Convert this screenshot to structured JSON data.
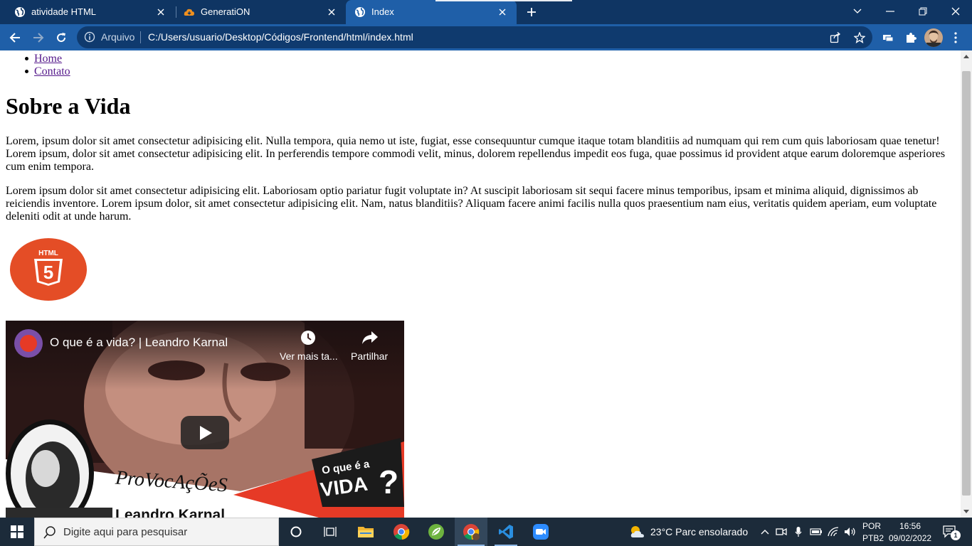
{
  "browser": {
    "tabs": [
      {
        "title": "atividade HTML",
        "icon": "globe-icon",
        "active": false
      },
      {
        "title": "GeneratiON",
        "icon": "cloud-icon",
        "active": false
      },
      {
        "title": "Index",
        "icon": "globe-icon",
        "active": true
      }
    ],
    "omnibox": {
      "scheme_label": "Arquivo",
      "url": "C:/Users/usuario/Desktop/Códigos/Frontend/html/index.html"
    },
    "colors": {
      "tabstrip": "#0f3563",
      "toolbar": "#1f5fa8",
      "omnibox": "#0f3a6e"
    }
  },
  "page": {
    "nav": [
      "Home",
      "Contato"
    ],
    "heading": "Sobre a Vida",
    "paragraphs": [
      "Lorem, ipsum dolor sit amet consectetur adipisicing elit. Nulla tempora, quia nemo ut iste, fugiat, esse consequuntur cumque itaque totam blanditiis ad numquam qui rem cum quis laboriosam quae tenetur! Lorem ipsum, dolor sit amet consectetur adipisicing elit. In perferendis tempore commodi velit, minus, dolorem repellendus impedit eos fuga, quae possimus id provident atque earum doloremque asperiores cum enim tempora.",
      "Lorem ipsum dolor sit amet consectetur adipisicing elit. Laboriosam optio pariatur fugit voluptate in? At suscipit laboriosam sit sequi facere minus temporibus, ipsam et minima aliquid, dignissimos ab reiciendis inventore. Lorem ipsum dolor, sit amet consectetur adipisicing elit. Nam, natus blanditiis? Aliquam facere animi facilis nulla quos praesentium nam eius, veritatis quidem aperiam, eum voluptate deleniti odit at unde harum."
    ],
    "logo": {
      "top_text": "HTML",
      "number": "5",
      "color": "#e44d26"
    },
    "video": {
      "title": "O que é a vida? | Leandro Karnal",
      "watch_later": "Ver mais ta...",
      "share": "Partilhar",
      "brand": "ProVocAçÕeS",
      "badge_line1": "O que é a",
      "badge_line2": "VIDA",
      "badge_mark": "?",
      "caption": "Leandro Karnal"
    }
  },
  "taskbar": {
    "search_placeholder": "Digite aqui para pesquisar",
    "weather": "23°C  Parc ensolarado",
    "lang_top": "POR",
    "lang_bottom": "PTB2",
    "time": "16:56",
    "date": "09/02/2022",
    "notification_count": "1"
  }
}
